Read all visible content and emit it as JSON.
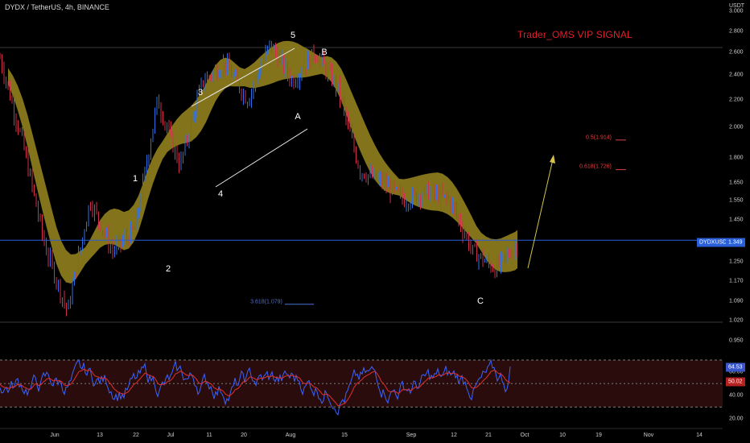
{
  "header": {
    "symbol": "DYDX / TetherUS, 4h, BINANCE"
  },
  "watermark": "Trader_OMS VIP SIGNAL",
  "price_axis": {
    "unit": "USDT",
    "ticks": [
      "3.000",
      "2.800",
      "2.600",
      "2.400",
      "2.200",
      "2.000",
      "1.800",
      "1.650",
      "1.550",
      "1.450",
      "1.250",
      "1.170",
      "1.090",
      "1.020",
      "0.950"
    ]
  },
  "badges": {
    "symbol": "DYDXUSDT",
    "price": "1.349",
    "osc_upper": "64.53",
    "osc_lower": "50.02"
  },
  "osc_axis": {
    "ticks": [
      "60.00",
      "40.00",
      "20.00"
    ]
  },
  "date_axis": {
    "ticks": [
      "Jun",
      "13",
      "22",
      "Jul",
      "11",
      "20",
      "Aug",
      "15",
      "Sep",
      "12",
      "21",
      "Oct",
      "10",
      "19",
      "Nov",
      "14"
    ]
  },
  "wave_labels": {
    "w1": "1",
    "w2": "2",
    "w3": "3",
    "w4": "4",
    "w5": "5",
    "wA": "A",
    "wB": "B",
    "wC": "C"
  },
  "fib_labels": {
    "f05": "0.5(1.914)",
    "f0618": "0.618(1.726)",
    "f3618": "3.618(1.079)"
  },
  "colors": {
    "background": "#000000",
    "cloud": "#8a7a1e",
    "candle_up": "#2f6fe0",
    "candle_down": "#d0304a",
    "rsi_line": "#3a64ff",
    "rsi_signal": "#e03030",
    "rsi_band": "#2a0c0c",
    "price_line": "#2a5fd8",
    "watermark": "#e0202a",
    "projection": "#d4c34a"
  },
  "chart_data": {
    "type": "line",
    "title": "DYDX / TetherUS, 4h, BINANCE",
    "xlabel": "",
    "ylabel": "USDT",
    "log_scale": true,
    "ylim": [
      0.95,
      3.0
    ],
    "current_price": 1.349,
    "x": [
      "Jun 1",
      "Jun 8",
      "Jun 13",
      "Jun 17",
      "Jun 22",
      "Jun 26",
      "Jul 1",
      "Jul 5",
      "Jul 11",
      "Jul 15",
      "Jul 20",
      "Jul 26",
      "Aug 1",
      "Aug 3",
      "Aug 8",
      "Aug 15",
      "Aug 20",
      "Aug 27",
      "Sep 1",
      "Sep 5",
      "Sep 12",
      "Sep 17",
      "Sep 21",
      "Sep 24"
    ],
    "series": [
      {
        "values": [
          2.55,
          1.9,
          1.32,
          1.05,
          1.55,
          1.3,
          1.4,
          2.2,
          1.75,
          2.35,
          2.5,
          2.2,
          2.68,
          2.35,
          2.6,
          2.3,
          1.72,
          1.65,
          1.55,
          1.6,
          1.55,
          1.3,
          1.22,
          1.33
        ]
      }
    ],
    "fib_levels": [
      {
        "label": "0.5(1.914)",
        "value": 1.914
      },
      {
        "label": "0.618(1.726)",
        "value": 1.726
      },
      {
        "label": "3.618(1.079)",
        "value": 1.079
      }
    ],
    "wave_points": [
      "1",
      "2",
      "3",
      "4",
      "5",
      "A",
      "B",
      "C"
    ],
    "oscillator": {
      "ylim": [
        20,
        70
      ],
      "ticks": [
        60,
        40,
        20
      ],
      "last_values": [
        64.53,
        50.02
      ]
    },
    "grid": false,
    "legend": "none"
  }
}
